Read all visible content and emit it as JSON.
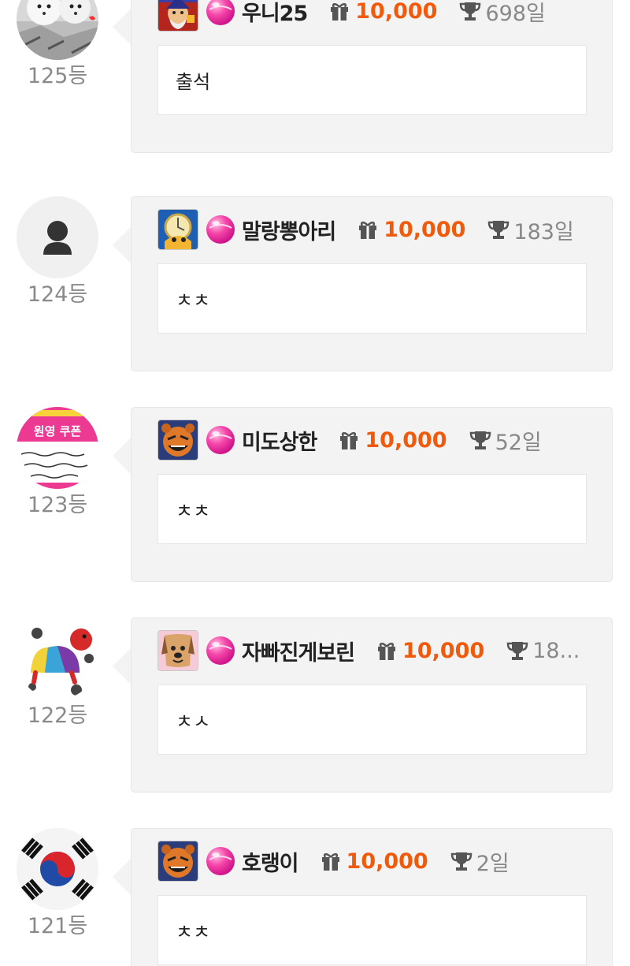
{
  "entries": [
    {
      "rank": "125등",
      "nick": "우니25",
      "points": "10,000",
      "days": "698일",
      "message": "출석",
      "avatar_icon": "puppies-photo-avatar",
      "level_icon": "wizard-level-icon"
    },
    {
      "rank": "124등",
      "nick": "말랑뽕아리",
      "points": "10,000",
      "days": "183일",
      "message": "ㅊㅊ",
      "avatar_icon": "default-person-avatar",
      "level_icon": "clock-knight-level-icon"
    },
    {
      "rank": "123등",
      "nick": "미도상한",
      "points": "10,000",
      "days": "52일",
      "message": "ㅊㅊ",
      "avatar_icon": "coupon-avatar",
      "level_icon": "bear-level-icon"
    },
    {
      "rank": "122등",
      "nick": "자빠진게보린",
      "points": "10,000",
      "days": "18...",
      "message": "ㅊㅅ",
      "avatar_icon": "turtle-avatar",
      "level_icon": "dog-level-icon"
    },
    {
      "rank": "121등",
      "nick": "호랭이",
      "points": "10,000",
      "days": "2일",
      "message": "ㅊㅊ",
      "avatar_icon": "korea-flag-avatar",
      "level_icon": "bear-level-icon"
    }
  ],
  "coupon_avatar_text": "원영 쿠폰",
  "colors": {
    "points": "#f05a0a",
    "card_bg": "#f3f3f3",
    "rank_text": "#8a8a8a"
  }
}
